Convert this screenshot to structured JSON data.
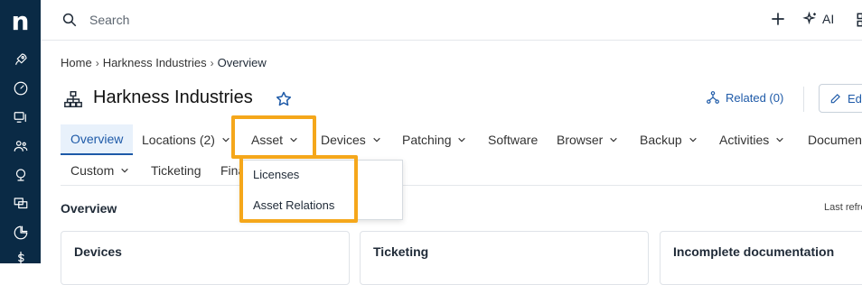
{
  "app": {
    "logo_letter": "n"
  },
  "sidebar": {
    "icons": [
      "rocket-icon",
      "gauge-icon",
      "devices-icon",
      "users-icon",
      "support-icon",
      "monitor-icon",
      "pie-chart-icon",
      "dollar-icon"
    ]
  },
  "topbar": {
    "search_placeholder": "Search",
    "ai_label": "AI"
  },
  "breadcrumb": {
    "items": [
      "Home",
      "Harkness Industries",
      "Overview"
    ]
  },
  "page": {
    "title": "Harkness Industries",
    "related_label": "Related (0)",
    "edit_label": "Edit"
  },
  "tabs": [
    {
      "label": "Overview",
      "has_menu": false,
      "active": true
    },
    {
      "label": "Locations (2)",
      "has_menu": true
    },
    {
      "label": "Asset",
      "has_menu": true
    },
    {
      "label": "Devices",
      "has_menu": true
    },
    {
      "label": "Patching",
      "has_menu": true
    },
    {
      "label": "Software",
      "has_menu": false
    },
    {
      "label": "Browser",
      "has_menu": true
    },
    {
      "label": "Backup",
      "has_menu": true
    },
    {
      "label": "Activities",
      "has_menu": true
    },
    {
      "label": "Documentation",
      "has_menu": false
    },
    {
      "label": "Custom",
      "has_menu": true
    },
    {
      "label": "Ticketing",
      "has_menu": false
    },
    {
      "label": "Finance",
      "has_menu": false
    }
  ],
  "asset_menu": {
    "items": [
      "Licenses",
      "Asset Relations"
    ]
  },
  "overview": {
    "section_title": "Overview",
    "last_refresh": "Last refreshed",
    "cards": [
      "Devices",
      "Ticketing",
      "Incomplete documentation"
    ]
  },
  "colors": {
    "rail": "#0a2a45",
    "accent": "#1e5aa8",
    "highlight": "#f5a71b"
  }
}
